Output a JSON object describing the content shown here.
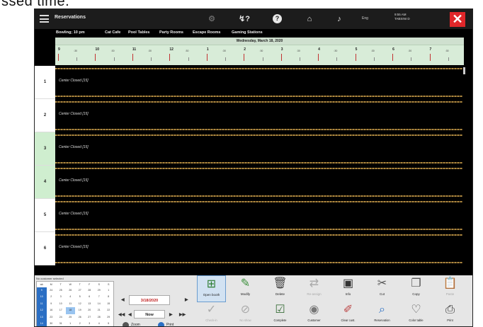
{
  "top_text": "ssed time.",
  "titlebar": {
    "menu_icon": "hamburger-icon",
    "title": "Reservations",
    "icons": [
      "settings-icon",
      "help-question-icon",
      "help-circle-icon",
      "building-icon",
      "notification-bell-icon"
    ],
    "user_short": "Eng",
    "user_line1": "9:55 AM",
    "user_line2": "TABSINI D",
    "close_icon": "close-icon"
  },
  "tabs": [
    "Bowling; 10 pm",
    "Cat Cafe",
    "Pool Tables",
    "Party Rooms",
    "Escape Rooms",
    "Gaming Stations"
  ],
  "timeline": {
    "date": "Wednesday, March 18, 2020",
    "hours": [
      "9",
      "10",
      "11",
      "12",
      "1",
      "2",
      "3",
      "4",
      "5",
      "6",
      "7"
    ],
    "minute_label": "9:30"
  },
  "rows": [
    {
      "number": "1",
      "status": "Center Closed [15]"
    },
    {
      "number": "2",
      "status": "Center Closed [15]"
    },
    {
      "number": "3",
      "status": "Center Closed [15]"
    },
    {
      "number": "4",
      "status": "Center Closed [15]"
    },
    {
      "number": "5",
      "status": "Center Closed [15]"
    },
    {
      "number": "6",
      "status": "Center Closed [15]"
    }
  ],
  "bottom": {
    "customer_label": "No customer selected",
    "calendar": {
      "days": [
        "wk",
        "M",
        "T",
        "W",
        "T",
        "F",
        "S",
        "S"
      ],
      "cells": [
        "9",
        "24",
        "25",
        "26",
        "27",
        "28",
        "29",
        "1",
        "10",
        "2",
        "3",
        "4",
        "5",
        "6",
        "7",
        "8",
        "11",
        "9",
        "10",
        "11",
        "12",
        "13",
        "14",
        "15",
        "12",
        "16",
        "17",
        "18",
        "19",
        "20",
        "21",
        "22",
        "13",
        "23",
        "24",
        "25",
        "26",
        "27",
        "28",
        "29",
        "14",
        "30",
        "31",
        "1",
        "2",
        "3",
        "4",
        "5"
      ]
    },
    "date": "3/18/2020",
    "today": "Now",
    "zoom_label": "Zoom",
    "print_label": "Print",
    "tools_row1": [
      {
        "icon": "open-booth-icon",
        "label": "Open booth",
        "state": "active"
      },
      {
        "icon": "modify-icon",
        "label": "Modify",
        "state": "normal"
      },
      {
        "icon": "delete-icon",
        "label": "Delete",
        "state": "normal"
      },
      {
        "icon": "reassign-icon",
        "label": "Re-assign",
        "state": "disabled"
      },
      {
        "icon": "info-icon",
        "label": "Info",
        "state": "normal"
      },
      {
        "icon": "cut-icon",
        "label": "Cut",
        "state": "normal"
      },
      {
        "icon": "copy-icon",
        "label": "Copy",
        "state": "normal"
      },
      {
        "icon": "paste-icon",
        "label": "Paste",
        "state": "disabled"
      }
    ],
    "tools_row2": [
      {
        "icon": "check-in-icon",
        "label": "Check-in",
        "state": "disabled"
      },
      {
        "icon": "no-show-icon",
        "label": "No show",
        "state": "disabled"
      },
      {
        "icon": "complete-icon",
        "label": "Complete",
        "state": "normal"
      },
      {
        "icon": "customer-icon",
        "label": "Customer",
        "state": "normal"
      },
      {
        "icon": "clear-cust-icon",
        "label": "Clear cust.",
        "state": "normal"
      },
      {
        "icon": "reservation-search-icon",
        "label": "Reservation",
        "state": "normal"
      },
      {
        "icon": "color-table-icon",
        "label": "Color table",
        "state": "normal"
      },
      {
        "icon": "printer-icon",
        "label": "Print",
        "state": "normal"
      }
    ]
  },
  "colors": {
    "close": "#e0272a",
    "timeline_bg": "#d8ecd8",
    "selected_row": "#cfeecf",
    "stripe": "#b08a40",
    "date_text": "#c02020"
  }
}
